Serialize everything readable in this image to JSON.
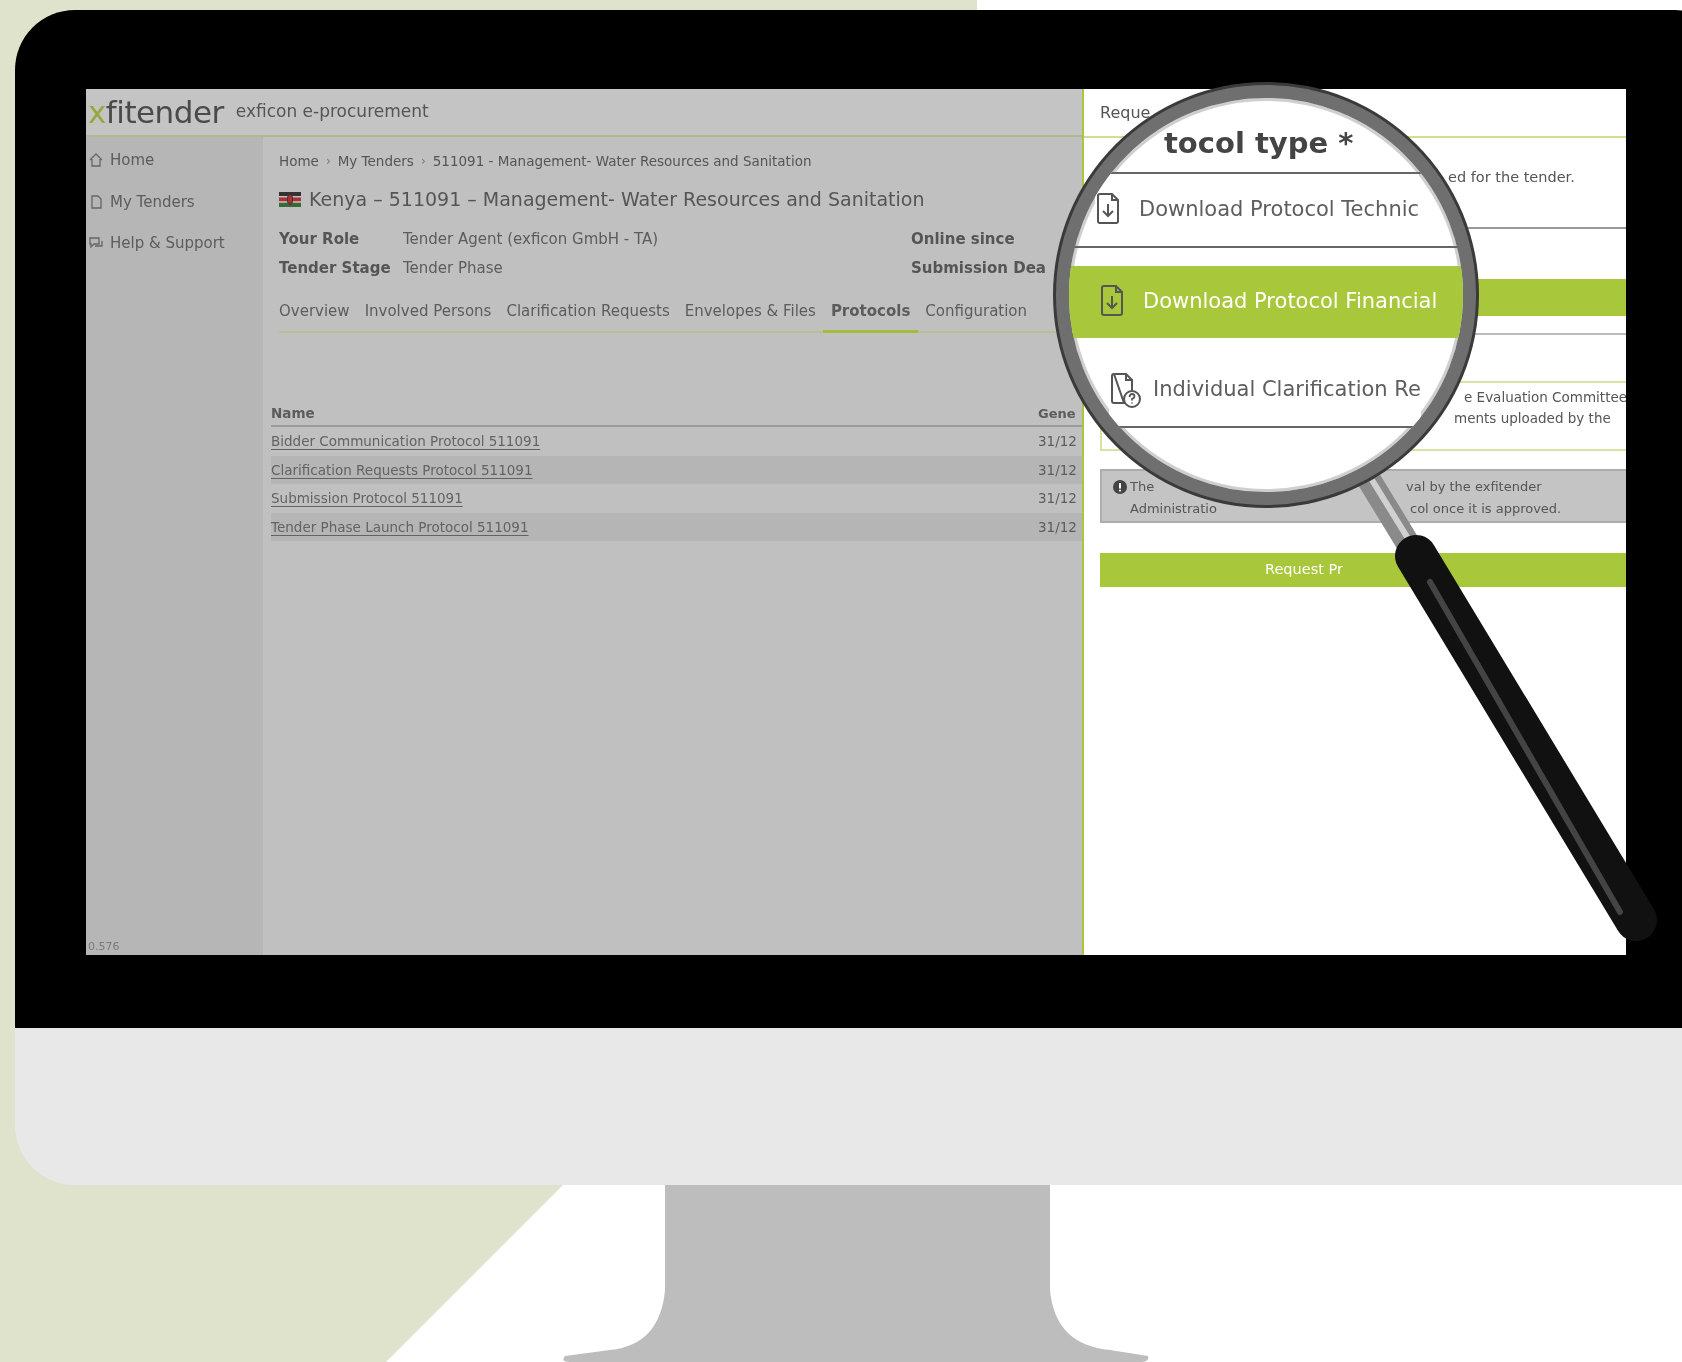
{
  "brand": {
    "accent": "x",
    "name": "fitender",
    "subtitle": "exficon e-procurement"
  },
  "sidebar": {
    "items": [
      {
        "kind": "home",
        "label": "Home"
      },
      {
        "kind": "document",
        "label": "My Tenders"
      },
      {
        "kind": "help",
        "label": "Help & Support"
      }
    ],
    "version": "0.576"
  },
  "breadcrumb": [
    {
      "kind": "link",
      "text": "Home"
    },
    {
      "kind": "sep",
      "text": "›"
    },
    {
      "kind": "link",
      "text": "My Tenders"
    },
    {
      "kind": "sep",
      "text": "›"
    },
    {
      "kind": "link",
      "text": "511091 - Management- Water Resources and Sanitation"
    }
  ],
  "tender": {
    "title": "Kenya – 511091 – Management- Water Resources and Sanitation",
    "fields": [
      {
        "label": "Your Role",
        "value": "Tender Agent (exficon GmbH - TA)",
        "side_label": "Online since"
      },
      {
        "label": "Tender Stage",
        "value": "Tender Phase",
        "side_label": "Submission Dea"
      }
    ]
  },
  "tabs": [
    {
      "label": "Overview",
      "selected": false
    },
    {
      "label": "Involved Persons",
      "selected": false
    },
    {
      "label": "Clarification Requests",
      "selected": false
    },
    {
      "label": "Envelopes & Files",
      "selected": false
    },
    {
      "label": "Protocols",
      "selected": true
    },
    {
      "label": "Configuration",
      "selected": false
    }
  ],
  "table": {
    "columns": [
      "Name",
      "Gene"
    ],
    "rows": [
      {
        "name": "Bidder Communication Protocol 511091",
        "date": "31/12"
      },
      {
        "name": "Clarification Requests Protocol 511091",
        "date": "31/12"
      },
      {
        "name": "Submission Protocol 511091",
        "date": "31/12"
      },
      {
        "name": "Tender Phase Launch Protocol 511091",
        "date": "31/12"
      }
    ]
  },
  "request_panel": {
    "title": "Reque",
    "note": "ed for the tender.",
    "committee_lines": [
      "e Evaluation Committee",
      "ments uploaded by the"
    ],
    "info_lines": [
      "The",
      "val by the exfitender",
      "Administratio",
      "col once it is approved."
    ],
    "button": "Request Pr"
  },
  "magnifier": {
    "heading": "tocol type *",
    "options": [
      {
        "kind": "download",
        "label": "Download Protocol Technic",
        "selected": false
      },
      {
        "kind": "download",
        "label": "Download Protocol Financial",
        "selected": true
      },
      {
        "kind": "question",
        "label": "Individual Clarification Re",
        "selected": false
      }
    ]
  }
}
